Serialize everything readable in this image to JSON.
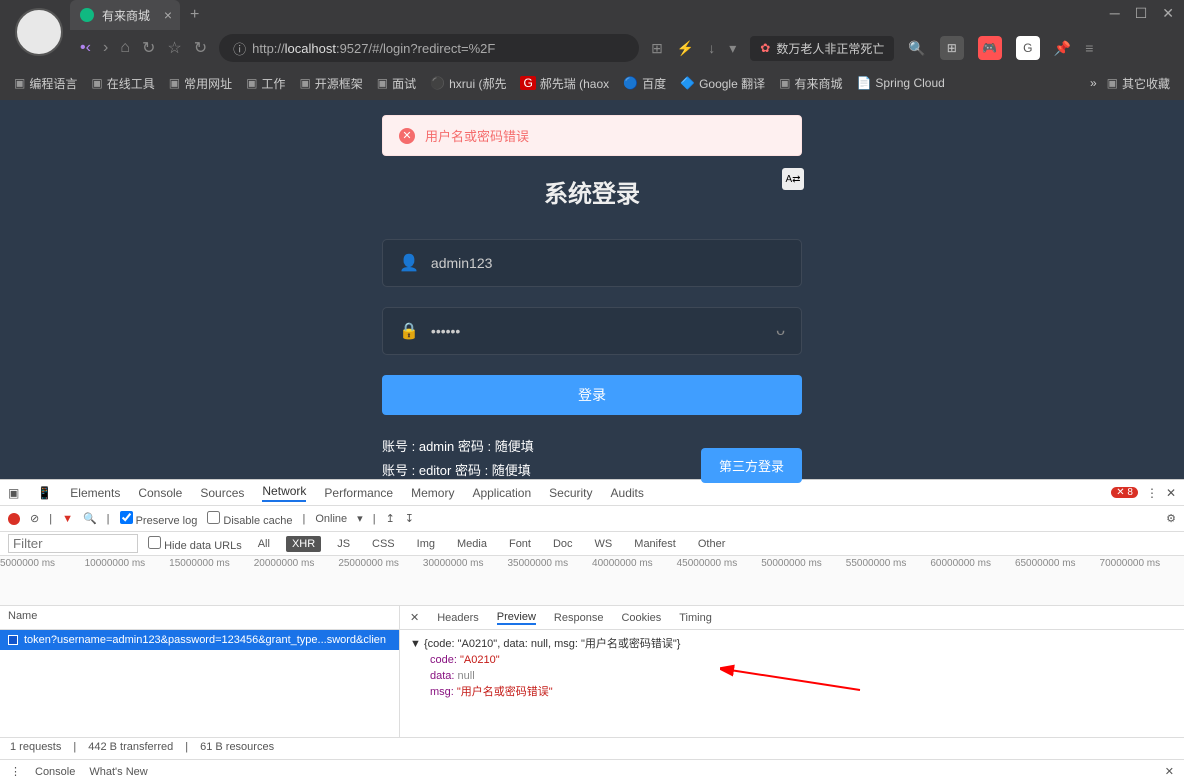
{
  "browser": {
    "tab_title": "有来商城",
    "url_prefix": "http://",
    "url_host": "localhost",
    "url_rest": ":9527/#/login?redirect=%2F",
    "news_text": "数万老人非正常死亡",
    "bookmarks": [
      "编程语言",
      "在线工具",
      "常用网址",
      "工作",
      "开源框架",
      "面试",
      "hxrui (郝先",
      "郝先瑞 (haox",
      "百度",
      "Google 翻译",
      "有来商城",
      "Spring Cloud"
    ],
    "bm_other": "其它收藏"
  },
  "page": {
    "error_msg": "用户名或密码错误",
    "title": "系统登录",
    "username": "admin123",
    "password": "••••••",
    "login_btn": "登录",
    "hint1": "账号 : admin    密码 : 随便填",
    "hint2": "账号 : editor    密码 : 随便填",
    "third_login": "第三方登录"
  },
  "devtools": {
    "tabs": [
      "Elements",
      "Console",
      "Sources",
      "Network",
      "Performance",
      "Memory",
      "Application",
      "Security",
      "Audits"
    ],
    "active_tab": "Network",
    "error_count": "8",
    "preserve_log": "Preserve log",
    "disable_cache": "Disable cache",
    "online": "Online",
    "filter_label": "Filter",
    "hide_urls": "Hide data URLs",
    "filter_types": [
      "All",
      "XHR",
      "JS",
      "CSS",
      "Img",
      "Media",
      "Font",
      "Doc",
      "WS",
      "Manifest",
      "Other"
    ],
    "active_filter": "XHR",
    "timeline_ticks": [
      "5000000 ms",
      "10000000 ms",
      "15000000 ms",
      "20000000 ms",
      "25000000 ms",
      "30000000 ms",
      "35000000 ms",
      "40000000 ms",
      "45000000 ms",
      "50000000 ms",
      "55000000 ms",
      "60000000 ms",
      "65000000 ms",
      "70000000 ms"
    ],
    "name_header": "Name",
    "request_name": "token?username=admin123&password=123456&grant_type...sword&clien",
    "right_tabs": [
      "Headers",
      "Preview",
      "Response",
      "Cookies",
      "Timing"
    ],
    "active_right": "Preview",
    "json_summary": "{code: \"A0210\", data: null, msg: \"用户名或密码错误\"}",
    "json_code_k": "code:",
    "json_code_v": "\"A0210\"",
    "json_data_k": "data:",
    "json_data_v": "null",
    "json_msg_k": "msg:",
    "json_msg_v": "\"用户名或密码错误\"",
    "status": [
      "1 requests",
      "442 B transferred",
      "61 B resources"
    ],
    "console_tab": "Console",
    "whatsnew": "What's New"
  }
}
